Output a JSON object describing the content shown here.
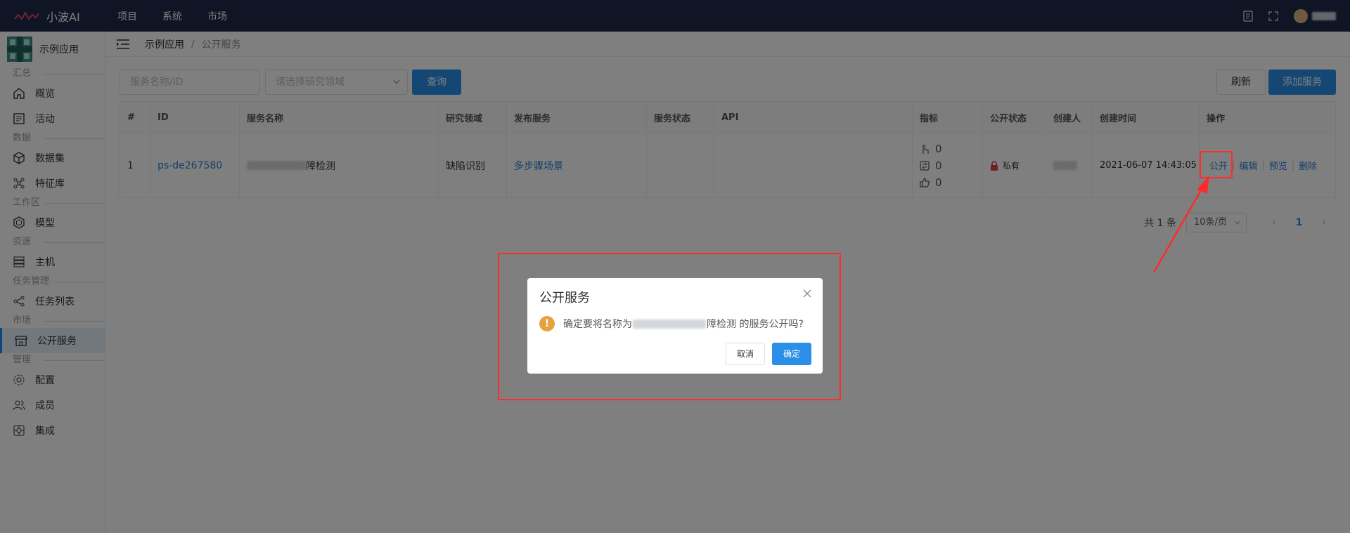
{
  "topbar": {
    "brand": "小波AI",
    "nav": [
      "项目",
      "系统",
      "市场"
    ]
  },
  "sidebar": {
    "app_name": "示例应用",
    "groups": [
      {
        "label": "汇总",
        "items": [
          "概览",
          "活动"
        ]
      },
      {
        "label": "数据",
        "items": [
          "数据集",
          "特征库"
        ]
      },
      {
        "label": "工作区",
        "items": [
          "模型"
        ]
      },
      {
        "label": "资源",
        "items": [
          "主机"
        ]
      },
      {
        "label": "任务管理",
        "items": [
          "任务列表"
        ]
      },
      {
        "label": "市场",
        "items": [
          "公开服务"
        ]
      },
      {
        "label": "管理",
        "items": [
          "配置",
          "成员",
          "集成"
        ]
      }
    ],
    "active_item": "公开服务"
  },
  "breadcrumb": {
    "app": "示例应用",
    "separator": "/",
    "page": "公开服务"
  },
  "toolbar": {
    "search_placeholder": "服务名称/ID",
    "domain_placeholder": "请选择研究领域",
    "query_label": "查询",
    "refresh_label": "刷新",
    "add_label": "添加服务"
  },
  "table": {
    "columns": [
      "#",
      "ID",
      "服务名称",
      "研究领域",
      "发布服务",
      "服务状态",
      "API",
      "指标",
      "公开状态",
      "创建人",
      "创建时间",
      "操作"
    ],
    "row": {
      "index": "1",
      "id": "ps-de267580",
      "name_suffix": "障检测",
      "domain": "缺陷识别",
      "publish": "多步骤场景",
      "status": "",
      "api": "",
      "metric_clicks": "0",
      "metric_calls": "0",
      "metric_likes": "0",
      "public_status": "私有",
      "created_at": "2021-06-07 14:43:05",
      "actions": [
        "公开",
        "编辑",
        "预览",
        "删除"
      ]
    }
  },
  "pagination": {
    "total": "共 1 条",
    "page_size": "10条/页",
    "current": "1"
  },
  "dialog": {
    "title": "公开服务",
    "message_prefix": "确定要将名称为",
    "message_mid": "障检测",
    "message_suffix": " 的服务公开吗?",
    "cancel_label": "取消",
    "confirm_label": "确定"
  },
  "colors": {
    "topbar": "#1e2a4a",
    "primary": "#2b8fe8",
    "annotation": "#ff2a2a",
    "warning": "#e6a23c"
  }
}
